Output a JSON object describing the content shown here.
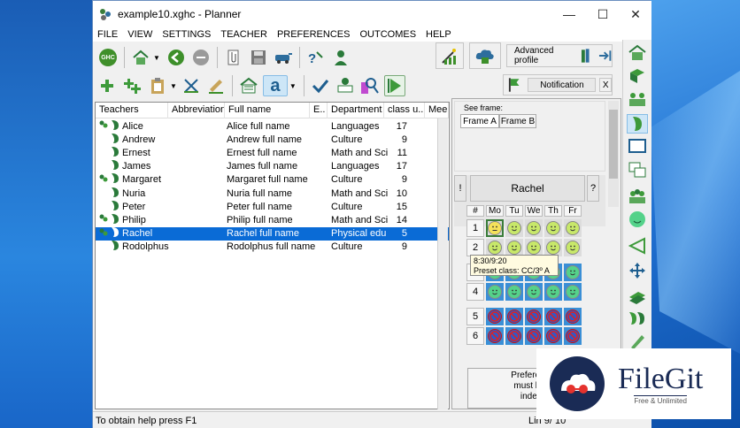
{
  "window": {
    "title": "example10.xghc - Planner",
    "minimize": "—",
    "maximize": "☐",
    "close": "✕"
  },
  "menu": [
    "FILE",
    "VIEW",
    "SETTINGS",
    "TEACHER",
    "PREFERENCES",
    "OUTCOMES",
    "HELP"
  ],
  "toolbar": {
    "ghc_label": "GHC",
    "advanced_profile": "Advanced profile",
    "notification": "Notification",
    "notification_close": "X",
    "letter_button": "a"
  },
  "table": {
    "columns": [
      "Teachers",
      "Abbreviation",
      "Full name",
      "E..",
      "Department",
      "class u...",
      "Mee"
    ],
    "rows": [
      {
        "name": "Alice",
        "full": "Alice full name",
        "dept": "Languages",
        "cls": "17",
        "group": true,
        "selected": false
      },
      {
        "name": "Andrew",
        "full": "Andrew full name",
        "dept": "Culture",
        "cls": "9",
        "group": false,
        "selected": false
      },
      {
        "name": "Ernest",
        "full": "Ernest full name",
        "dept": "Math and Sci",
        "cls": "11",
        "group": false,
        "selected": false
      },
      {
        "name": "James",
        "full": "James full name",
        "dept": "Languages",
        "cls": "17",
        "group": false,
        "selected": false
      },
      {
        "name": "Margaret",
        "full": "Margaret full name",
        "dept": "Culture",
        "cls": "9",
        "group": true,
        "selected": false
      },
      {
        "name": "Nuria",
        "full": "Nuria full name",
        "dept": "Math and Sci",
        "cls": "10",
        "group": false,
        "selected": false
      },
      {
        "name": "Peter",
        "full": "Peter full name",
        "dept": "Culture",
        "cls": "15",
        "group": false,
        "selected": false
      },
      {
        "name": "Philip",
        "full": "Philip full name",
        "dept": "Math and Sci",
        "cls": "14",
        "group": true,
        "selected": false
      },
      {
        "name": "Rachel",
        "full": "Rachel full name",
        "dept": "Physical edu",
        "cls": "5",
        "group": true,
        "selected": true
      },
      {
        "name": "Rodolphus",
        "full": "Rodolphus full name",
        "dept": "Culture",
        "cls": "9",
        "group": false,
        "selected": false
      }
    ]
  },
  "frames": {
    "label": "See frame:",
    "items": [
      "Frame A",
      "Frame B"
    ]
  },
  "teacher_panel": {
    "name": "Rachel",
    "left_btn": "!",
    "right_btn": "?"
  },
  "timetable": {
    "corner": "#",
    "days": [
      "Mo",
      "Tu",
      "We",
      "Th",
      "Fr"
    ],
    "periods": [
      "1",
      "2",
      "3",
      "4",
      "5",
      "6"
    ],
    "cells": [
      [
        "neutral",
        "happy",
        "happy",
        "happy",
        "happy"
      ],
      [
        "happy",
        "happy",
        "happy",
        "happy",
        "happy"
      ],
      [
        "green",
        "green",
        "green",
        "green",
        "green"
      ],
      [
        "green",
        "green",
        "green",
        "green",
        "green"
      ],
      [
        "blocked",
        "blocked",
        "blocked",
        "blocked",
        "blocked"
      ],
      [
        "blocked",
        "blocked",
        "blocked",
        "blocked",
        "blocked"
      ]
    ],
    "colors": {
      "neutral": "#f5e25a",
      "happy": "#c8e86a",
      "green": "#54d28a",
      "blocked": "#2f59c8",
      "cell_bg": "#3a8fd6"
    }
  },
  "tooltip": {
    "line1": "8:30/9:20",
    "line2": "Preset class: CC/3º A"
  },
  "preferences_text": {
    "l1": "Preferences and",
    "l2": "must be indicat",
    "l3": "independen"
  },
  "status": {
    "help": "To obtain help press F1",
    "pos": "Lin 9/ 10"
  },
  "watermark": {
    "brand": "FileGit",
    "tagline": "Free & Unlimited"
  }
}
